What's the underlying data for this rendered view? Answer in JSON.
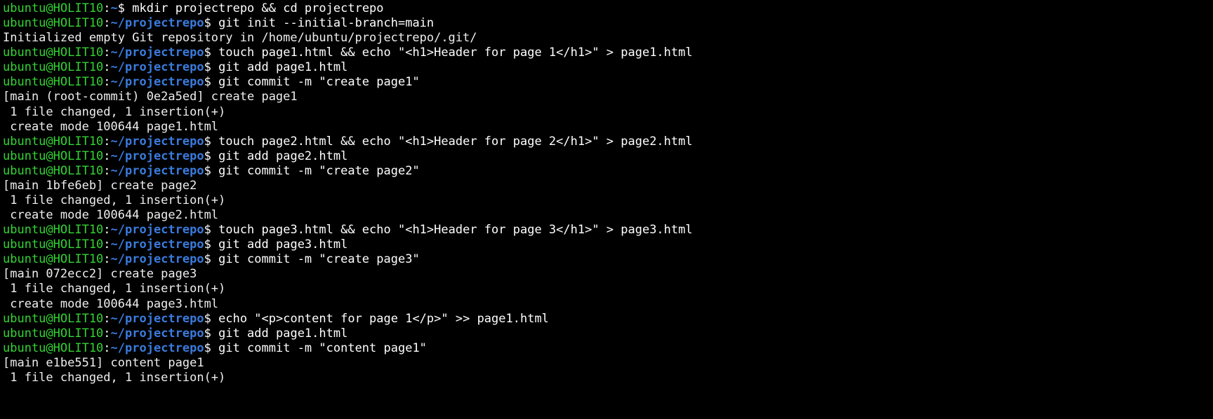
{
  "prompt": {
    "user": "ubuntu@HOLIT10",
    "path_home": "~",
    "path_repo": "~/projectrepo",
    "dollar": "$"
  },
  "lines": [
    {
      "type": "prompt",
      "path": "home",
      "cmd": "mkdir projectrepo && cd projectrepo"
    },
    {
      "type": "prompt",
      "path": "repo",
      "cmd": "git init --initial-branch=main"
    },
    {
      "type": "out",
      "text": "Initialized empty Git repository in /home/ubuntu/projectrepo/.git/"
    },
    {
      "type": "prompt",
      "path": "repo",
      "cmd": "touch page1.html && echo \"<h1>Header for page 1</h1>\" > page1.html"
    },
    {
      "type": "prompt",
      "path": "repo",
      "cmd": "git add page1.html"
    },
    {
      "type": "prompt",
      "path": "repo",
      "cmd": "git commit -m \"create page1\""
    },
    {
      "type": "out",
      "text": "[main (root-commit) 0e2a5ed] create page1"
    },
    {
      "type": "out",
      "text": " 1 file changed, 1 insertion(+)"
    },
    {
      "type": "out",
      "text": " create mode 100644 page1.html"
    },
    {
      "type": "prompt",
      "path": "repo",
      "cmd": "touch page2.html && echo \"<h1>Header for page 2</h1>\" > page2.html"
    },
    {
      "type": "prompt",
      "path": "repo",
      "cmd": "git add page2.html"
    },
    {
      "type": "prompt",
      "path": "repo",
      "cmd": "git commit -m \"create page2\""
    },
    {
      "type": "out",
      "text": "[main 1bfe6eb] create page2"
    },
    {
      "type": "out",
      "text": " 1 file changed, 1 insertion(+)"
    },
    {
      "type": "out",
      "text": " create mode 100644 page2.html"
    },
    {
      "type": "prompt",
      "path": "repo",
      "cmd": "touch page3.html && echo \"<h1>Header for page 3</h1>\" > page3.html"
    },
    {
      "type": "prompt",
      "path": "repo",
      "cmd": "git add page3.html"
    },
    {
      "type": "prompt",
      "path": "repo",
      "cmd": "git commit -m \"create page3\""
    },
    {
      "type": "out",
      "text": "[main 072ecc2] create page3"
    },
    {
      "type": "out",
      "text": " 1 file changed, 1 insertion(+)"
    },
    {
      "type": "out",
      "text": " create mode 100644 page3.html"
    },
    {
      "type": "prompt",
      "path": "repo",
      "cmd": "echo \"<p>content for page 1</p>\" >> page1.html"
    },
    {
      "type": "prompt",
      "path": "repo",
      "cmd": "git add page1.html"
    },
    {
      "type": "prompt",
      "path": "repo",
      "cmd": "git commit -m \"content page1\""
    },
    {
      "type": "out",
      "text": "[main e1be551] content page1"
    },
    {
      "type": "out",
      "text": " 1 file changed, 1 insertion(+)"
    }
  ]
}
